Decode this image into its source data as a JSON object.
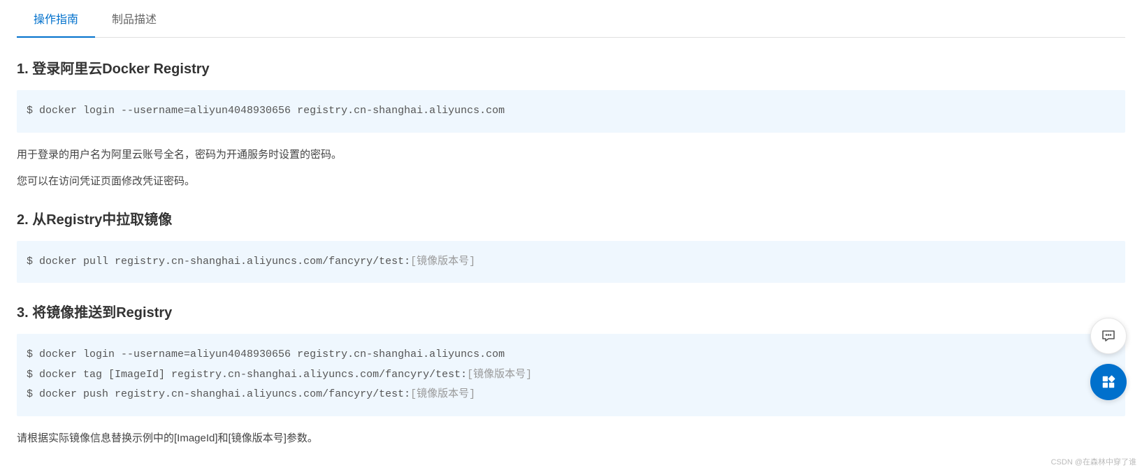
{
  "tabs": {
    "guide": "操作指南",
    "description": "制品描述"
  },
  "section1": {
    "heading": "1. 登录阿里云Docker Registry",
    "code": "$ docker login --username=aliyun4048930656 registry.cn-shanghai.aliyuncs.com",
    "desc1": "用于登录的用户名为阿里云账号全名，密码为开通服务时设置的密码。",
    "desc2": "您可以在访问凭证页面修改凭证密码。"
  },
  "section2": {
    "heading": "2. 从Registry中拉取镜像",
    "code_prefix": "$ docker pull registry.cn-shanghai.aliyuncs.com/fancyry/test:",
    "code_placeholder": "[镜像版本号]"
  },
  "section3": {
    "heading": "3. 将镜像推送到Registry",
    "line1": "$ docker login --username=aliyun4048930656 registry.cn-shanghai.aliyuncs.com",
    "line2_prefix": "$ docker tag [ImageId] registry.cn-shanghai.aliyuncs.com/fancyry/test:",
    "line2_placeholder": "[镜像版本号]",
    "line3_prefix": "$ docker push registry.cn-shanghai.aliyuncs.com/fancyry/test:",
    "line3_placeholder": "[镜像版本号]",
    "desc": "请根据实际镜像信息替换示例中的[ImageId]和[镜像版本号]参数。"
  },
  "watermark": "CSDN @在森林中穿了谁"
}
